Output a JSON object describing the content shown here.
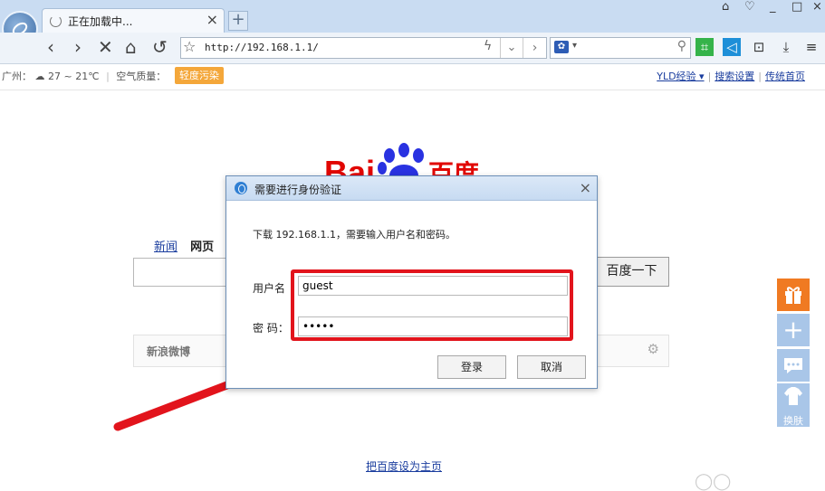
{
  "browser": {
    "tab_title": "正在加载中...",
    "new_tab_symbol": "+",
    "url": "http://192.168.1.1/",
    "search_engine_icon": "paw-icon",
    "window_buttons": [
      "⌂",
      "♡",
      "_",
      "□",
      "×"
    ]
  },
  "page": {
    "weather_city": "广州：",
    "weather_temp": "27 ~ 21℃",
    "air_label": "空气质量：",
    "air_value": "轻度污染",
    "top_links": {
      "user": "YLD经验 ▾",
      "search_settings": "搜索设置",
      "home": "传统首页"
    },
    "logo_left": "Bai",
    "logo_right": "百度",
    "nav_news": "新闻",
    "nav_web": "网页",
    "search_button": "百度一下",
    "weibo_label": "新浪微博",
    "set_home": "把百度设为主页",
    "skin_label": "换肤"
  },
  "dialog": {
    "title": "需要进行身份验证",
    "message": "下载 192.168.1.1，需要输入用户名和密码。",
    "username_label": "用户名",
    "username_value": "guest",
    "password_label": "密 码：",
    "password_value": "guest",
    "login_button": "登录",
    "cancel_button": "取消"
  },
  "colors": {
    "highlight": "#e2141c",
    "aqi": "#f4a73a",
    "gift": "#f07a22",
    "baidu_blue": "#2932e1",
    "baidu_red": "#e10602"
  }
}
